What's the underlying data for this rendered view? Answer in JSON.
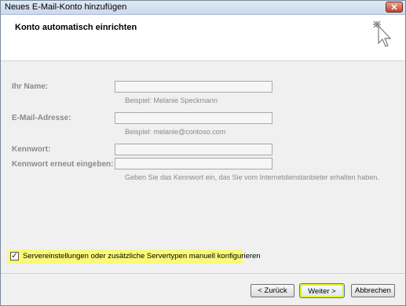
{
  "window": {
    "title": "Neues E-Mail-Konto hinzufügen",
    "close_label": "✕"
  },
  "header": {
    "title": "Konto automatisch einrichten",
    "icon": "cursor-sparkle-icon"
  },
  "form": {
    "name_label": "Ihr Name:",
    "name_value": "",
    "name_hint": "Beispiel: Melanie Speckmann",
    "email_label": "E-Mail-Adresse:",
    "email_value": "",
    "email_hint": "Beispiel: melanie@contoso.com",
    "password_label": "Kennwort:",
    "password_value": "",
    "password_confirm_label": "Kennwort erneut eingeben:",
    "password_confirm_value": "",
    "password_hint": "Geben Sie das Kennwort ein, das Sie vom Internetdienstanbieter erhalten haben."
  },
  "manual": {
    "checked": true,
    "check_mark": "✓",
    "label": "Servereinstellungen oder zusätzliche Servertypen manuell konfigurieren",
    "highlight_color": "#fbf97a"
  },
  "buttons": {
    "back": "< Zurück",
    "next": "Weiter >",
    "cancel": "Abbrechen"
  }
}
